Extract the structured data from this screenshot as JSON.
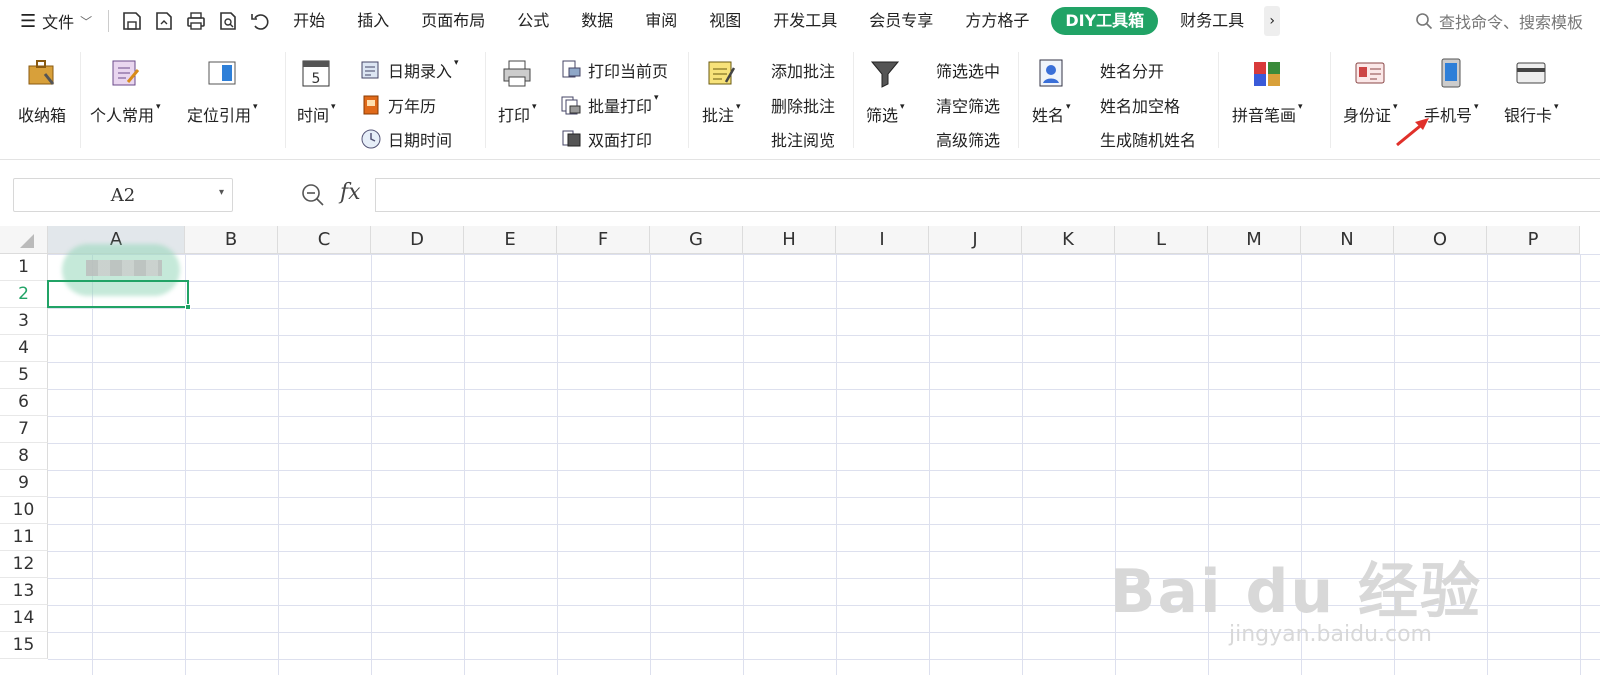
{
  "menubar": {
    "file_label": "文件",
    "tabs": [
      "开始",
      "插入",
      "页面布局",
      "公式",
      "数据",
      "审阅",
      "视图",
      "开发工具",
      "会员专享",
      "方方格子",
      "DIY工具箱",
      "财务工具"
    ],
    "active_tab": "DIY工具箱",
    "more_label": "›",
    "search_label": "查找命令、搜索模板"
  },
  "ribbon": {
    "storage": "收纳箱",
    "personal": "个人常用",
    "locate": "定位引用",
    "time": "时间",
    "date_entry": "日期录入",
    "calendar": "万年历",
    "datetime": "日期时间",
    "print": "打印",
    "print_current": "打印当前页",
    "batch_print": "批量打印",
    "duplex_print": "双面打印",
    "comment": "批注",
    "add_comment": "添加批注",
    "delete_comment": "删除批注",
    "read_comment": "批注阅览",
    "filter": "筛选",
    "filter_selected": "筛选选中",
    "clear_filter": "清空筛选",
    "advanced_filter": "高级筛选",
    "name": "姓名",
    "split_name": "姓名分开",
    "name_space": "姓名加空格",
    "random_name": "生成随机姓名",
    "pinyin": "拼音笔画",
    "id_card": "身份证",
    "phone": "手机号",
    "bank_card": "银行卡"
  },
  "formula": {
    "cell_ref": "A2",
    "fx": "fx",
    "value": ""
  },
  "grid": {
    "columns": [
      "A",
      "B",
      "C",
      "D",
      "E",
      "F",
      "G",
      "H",
      "I",
      "J",
      "K",
      "L",
      "M",
      "N",
      "O",
      "P"
    ],
    "rows": [
      "1",
      "2",
      "3",
      "4",
      "5",
      "6",
      "7",
      "8",
      "9",
      "10",
      "11",
      "12",
      "13",
      "14",
      "15"
    ]
  },
  "colors": {
    "accent": "#21a366",
    "arrow": "#e0302a"
  },
  "watermark": {
    "main": "Bai du 经验",
    "sub": "jingyan.baidu.com"
  }
}
